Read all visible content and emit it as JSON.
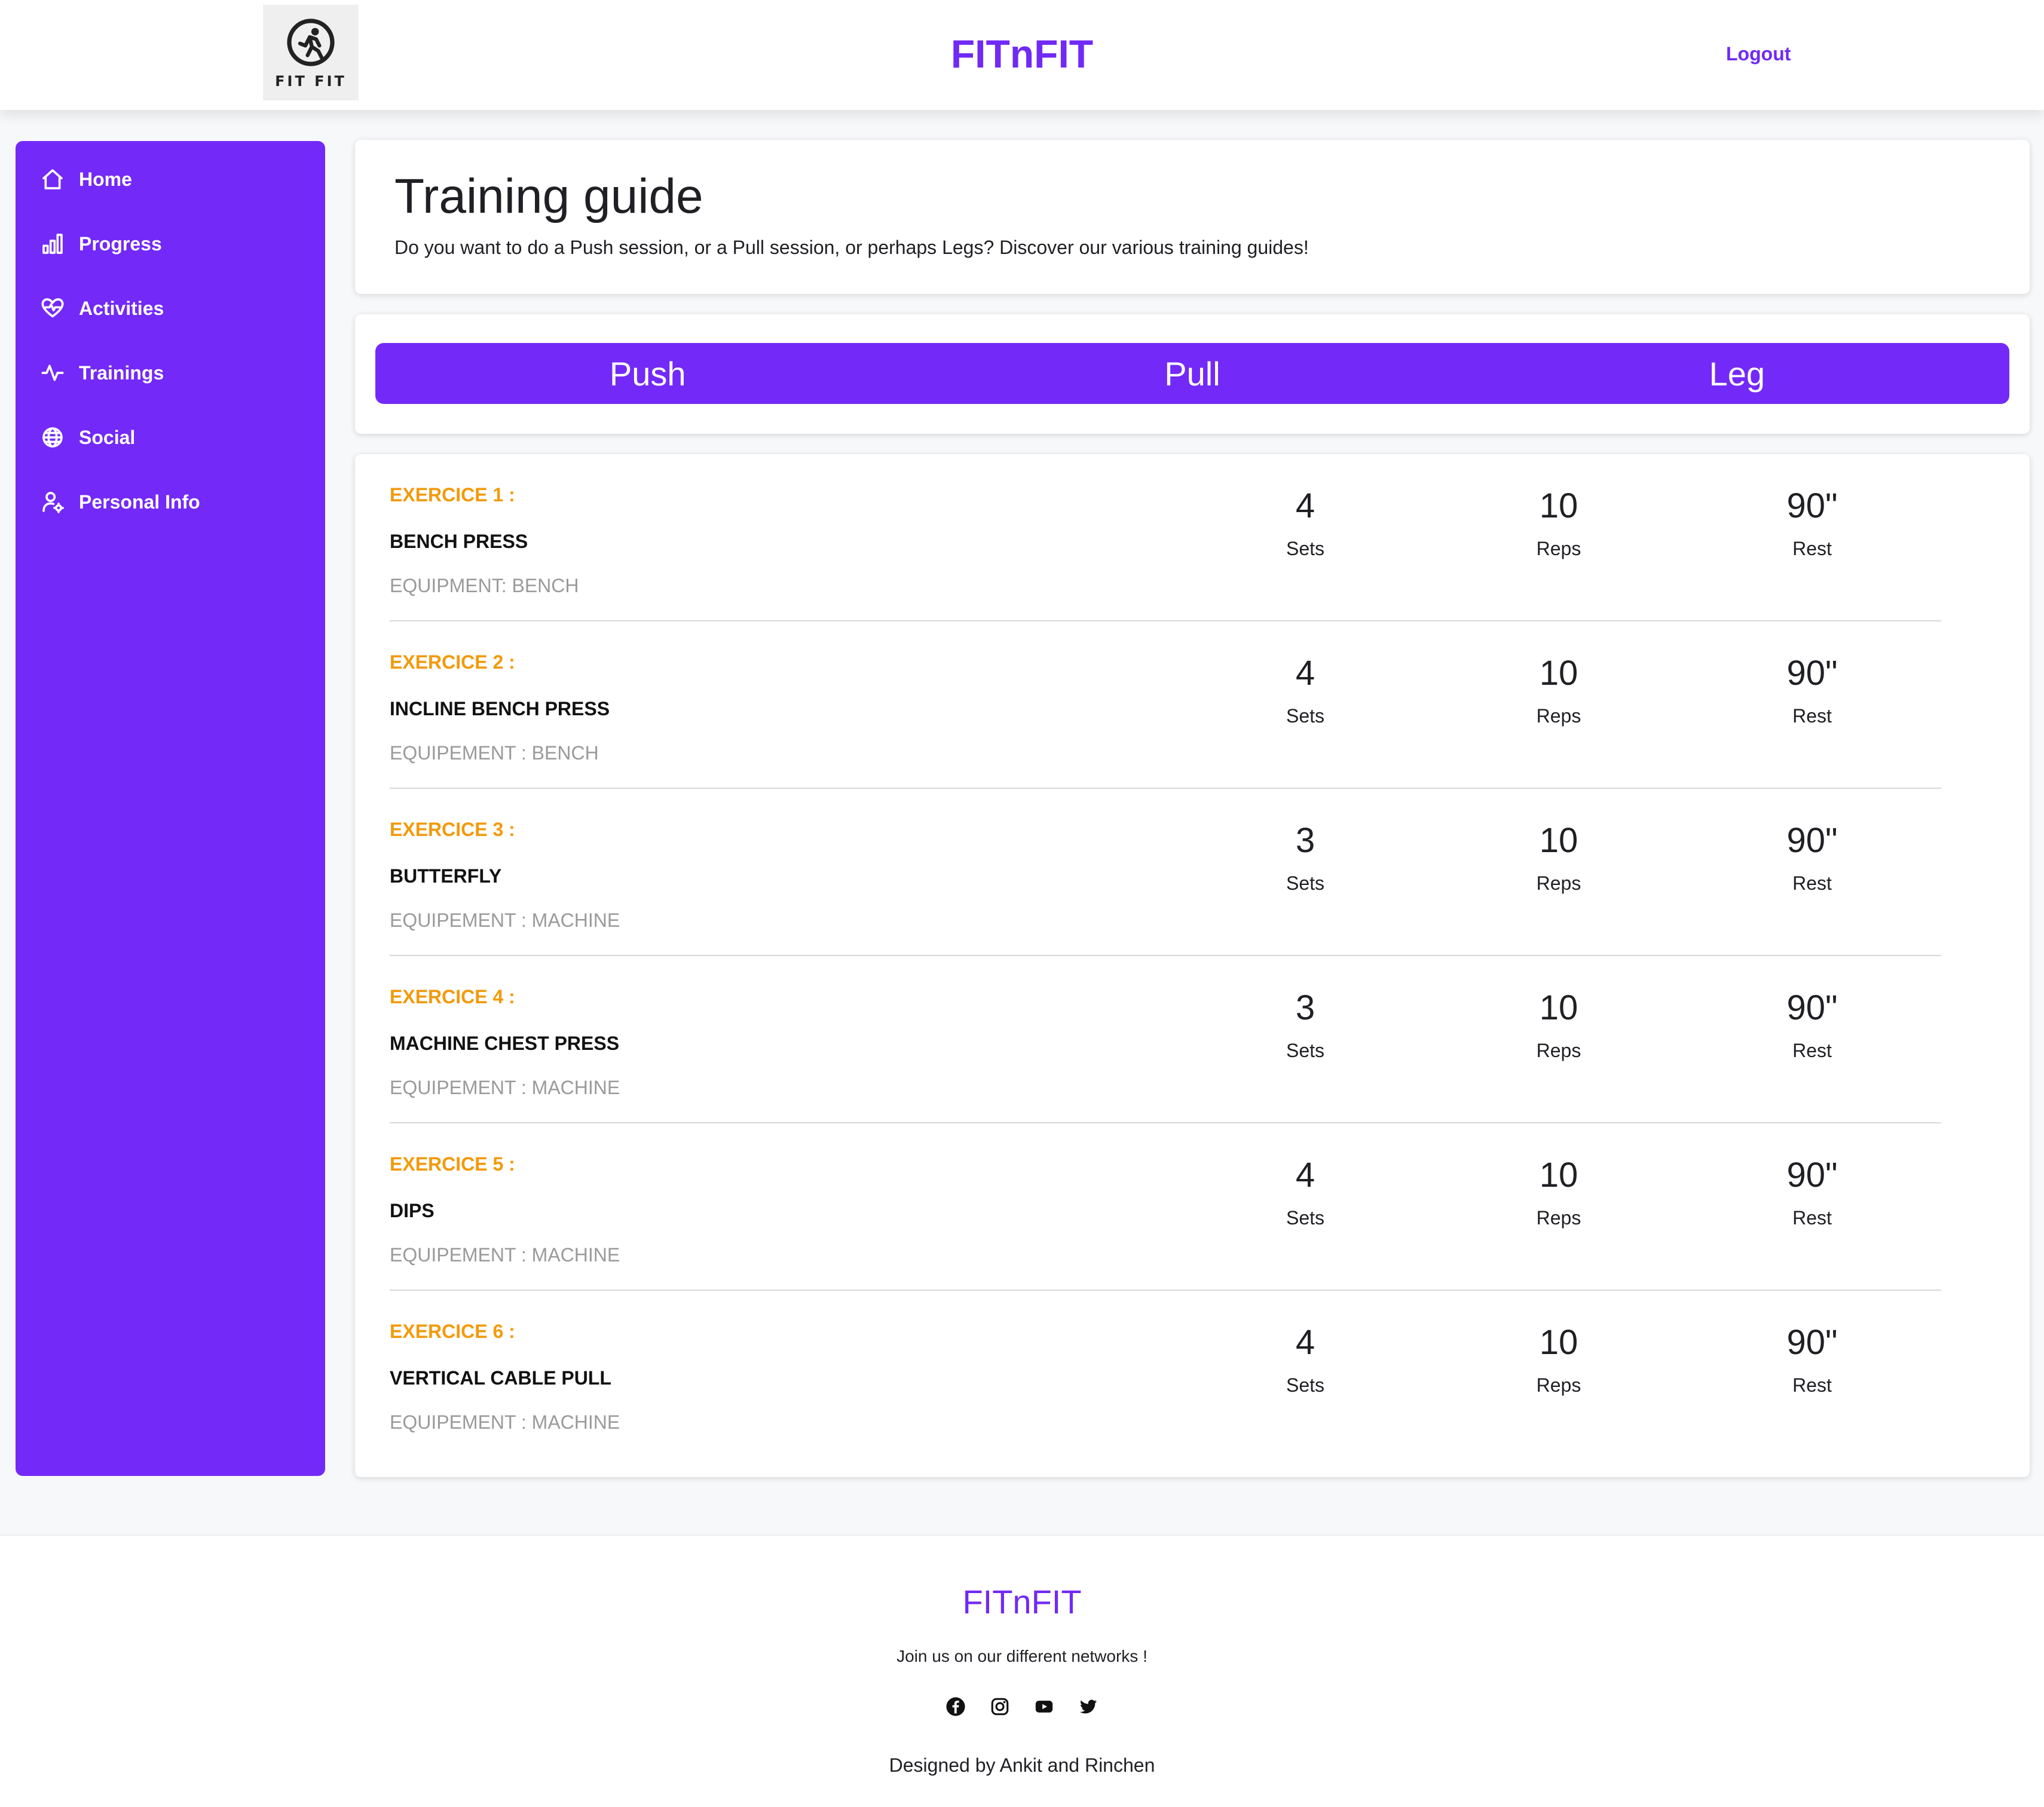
{
  "header": {
    "logo_text": "FIT FIT",
    "brand": "FITnFIT",
    "logout_label": "Logout"
  },
  "sidebar": {
    "items": [
      {
        "label": "Home",
        "icon": "home-icon"
      },
      {
        "label": "Progress",
        "icon": "bar-chart-icon"
      },
      {
        "label": "Activities",
        "icon": "heart-pulse-icon"
      },
      {
        "label": "Trainings",
        "icon": "activity-icon"
      },
      {
        "label": "Social",
        "icon": "globe-icon"
      },
      {
        "label": "Personal Info",
        "icon": "user-settings-icon"
      }
    ]
  },
  "intro": {
    "title": "Training guide",
    "subtitle": "Do you want to do a Push session, or a Pull session, or perhaps Legs? Discover our various training guides!"
  },
  "tabs": [
    "Push",
    "Pull",
    "Leg"
  ],
  "exercises": [
    {
      "number": "EXERCICE 1 :",
      "name": "BENCH PRESS",
      "equipment": "EQUIPMENT: BENCH",
      "sets": "4",
      "reps": "10",
      "rest": "90\""
    },
    {
      "number": "EXERCICE 2 :",
      "name": "INCLINE BENCH PRESS",
      "equipment": "EQUIPEMENT : BENCH",
      "sets": "4",
      "reps": "10",
      "rest": "90\""
    },
    {
      "number": "EXERCICE 3 :",
      "name": "BUTTERFLY",
      "equipment": "EQUIPEMENT : MACHINE",
      "sets": "3",
      "reps": "10",
      "rest": "90\""
    },
    {
      "number": "EXERCICE 4 :",
      "name": "MACHINE CHEST PRESS",
      "equipment": "EQUIPEMENT : MACHINE",
      "sets": "3",
      "reps": "10",
      "rest": "90\""
    },
    {
      "number": "EXERCICE 5 :",
      "name": "DIPS",
      "equipment": "EQUIPEMENT : MACHINE",
      "sets": "4",
      "reps": "10",
      "rest": "90\""
    },
    {
      "number": "EXERCICE 6 :",
      "name": "VERTICAL CABLE PULL",
      "equipment": "EQUIPEMENT : MACHINE",
      "sets": "4",
      "reps": "10",
      "rest": "90\""
    }
  ],
  "stat_labels": {
    "sets": "Sets",
    "reps": "Reps",
    "rest": "Rest"
  },
  "footer": {
    "brand": "FITnFIT",
    "join_text": "Join us on our different networks !",
    "social_icons": [
      "facebook-icon",
      "instagram-icon",
      "youtube-icon",
      "twitter-icon"
    ],
    "designed_by": "Designed by Ankit and Rinchen"
  },
  "colors": {
    "accent": "#7329f7",
    "exercise_number": "#f29a0c",
    "equipment_text": "#9a9a9a"
  }
}
